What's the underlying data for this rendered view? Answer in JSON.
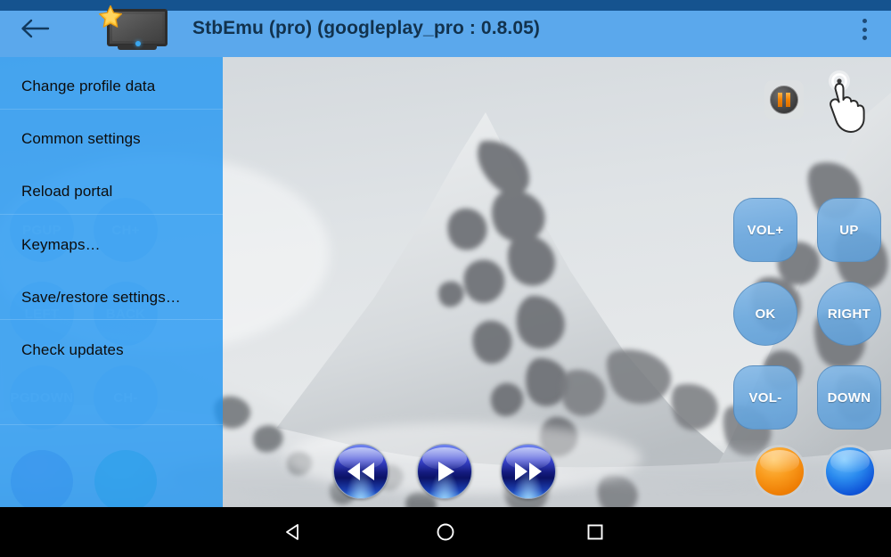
{
  "app": {
    "title": "StbEmu (pro) (googleplay_pro : 0.8.05)",
    "icon_name": "tv-star-icon",
    "status_bar_color": "#15538F",
    "app_bar_color": "#5BA8EC",
    "accent_color": "#2196F3"
  },
  "app_bar": {
    "back_icon": "arrow-left-icon",
    "overflow_icon": "overflow-menu-icon"
  },
  "drawer": {
    "background_color": "#2196F3",
    "items": [
      {
        "label": "Change profile data"
      },
      {
        "label": "Common settings"
      },
      {
        "label": "Reload portal"
      },
      {
        "label": "Keymaps…"
      },
      {
        "label": "Save/restore settings…"
      },
      {
        "label": "Check updates"
      }
    ]
  },
  "player": {
    "pause_icon": "pause-icon",
    "cursor_icon": "hand-tap-cursor-icon",
    "background_scene": "snowy-mountain"
  },
  "remote": {
    "buttons": [
      {
        "label": "VOL+",
        "name": "volume-up-button"
      },
      {
        "label": "UP",
        "name": "dpad-up-button"
      },
      {
        "label": "OK",
        "name": "ok-button"
      },
      {
        "label": "RIGHT",
        "name": "dpad-right-button"
      },
      {
        "label": "VOL-",
        "name": "volume-down-button"
      },
      {
        "label": "DOWN",
        "name": "dpad-down-button"
      }
    ],
    "hidden_buttons": [
      {
        "label": "PGUP",
        "name": "page-up-button"
      },
      {
        "label": "CH+",
        "name": "channel-up-button"
      },
      {
        "label": "LEFT",
        "name": "dpad-left-button"
      },
      {
        "label": "BACK",
        "name": "back-button"
      },
      {
        "label": "PGDOWN",
        "name": "page-down-button"
      },
      {
        "label": "CH-",
        "name": "channel-down-button"
      }
    ]
  },
  "transport": {
    "rewind": "rewind-icon",
    "play": "play-icon",
    "forward": "fast-forward-icon"
  },
  "color_keys": [
    {
      "name": "orange-color-button",
      "color": "#F7941E"
    },
    {
      "name": "blue-color-button",
      "color": "#1E7BE8"
    }
  ],
  "nav_bar": {
    "back": "nav-back-icon",
    "home": "nav-home-icon",
    "recents": "nav-recents-icon"
  }
}
